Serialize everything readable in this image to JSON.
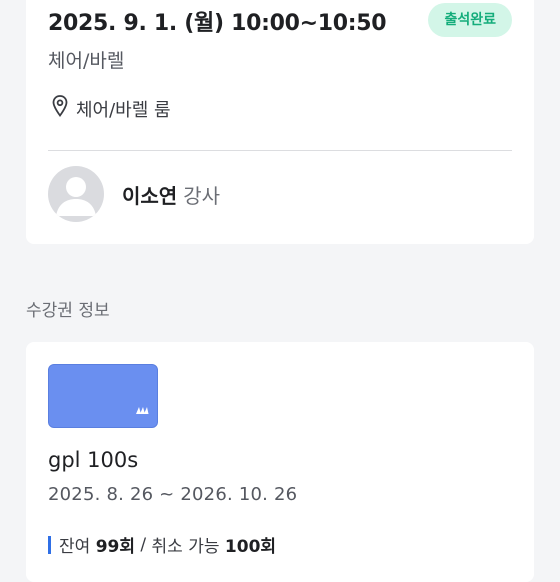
{
  "lesson": {
    "datetime": "2025. 9. 1. (월) 10:00~10:50",
    "status": "출석완료",
    "name": "체어/바렐",
    "room": "체어/바렐 룸",
    "instructor": {
      "name": "이소연",
      "role": "강사"
    }
  },
  "pass_section_title": "수강권 정보",
  "pass": {
    "name": "gpl 100s",
    "period": "2025. 8. 26 ~ 2026. 10. 26",
    "remaining_label": "잔여",
    "remaining_count": "99회",
    "separator": "/",
    "cancel_label": "취소 가능",
    "cancel_count": "100회"
  },
  "icons": [
    "location-pin-icon",
    "avatar-placeholder-icon",
    "brand-logo-icon"
  ],
  "colors": {
    "badge_bg": "#d3f6e8",
    "badge_text": "#14ad7b",
    "pass_card": "#6a8ff0",
    "accent_bar": "#2f6fe6"
  }
}
